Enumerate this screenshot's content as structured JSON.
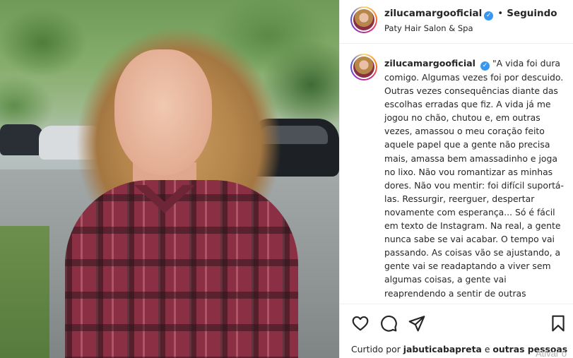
{
  "post": {
    "username": "zilucamargooficial",
    "separator": "•",
    "follow_status": "Seguindo",
    "location": "Paty Hair Salon & Spa"
  },
  "caption": {
    "username": "zilucamargooficial",
    "text": "\"A vida foi dura comigo. Algumas vezes foi por descuido. Outras vezes consequências diante das escolhas erradas que fiz. A vida já me jogou no chão, chutou e, em outras vezes, amassou o meu coração feito aquele papel que a gente não precisa mais, amassa bem amassadinho e joga no lixo. Não vou romantizar as minhas dores. Não vou mentir: foi difícil suportá-las. Ressurgir, reerguer, despertar novamente com esperança... Só é fácil em texto de Instagram. Na real, a gente nunca sabe se vai acabar. O tempo vai passando. As coisas vão se ajustando, a gente vai se readaptando a viver sem algumas coisas, a gente vai reaprendendo a sentir de outras"
  },
  "likes": {
    "prefix": "Curtido por",
    "user": "jabuticabapreta",
    "conjunction": "e",
    "others": "outras pessoas"
  },
  "icons": {
    "verified": "verified-badge-icon",
    "like": "heart-icon",
    "comment": "comment-icon",
    "share": "paper-plane-icon",
    "save": "bookmark-icon"
  },
  "watermark": "Ativar o",
  "colors": {
    "verified_blue": "#3897f0",
    "text": "#262626",
    "border": "#efefef"
  }
}
